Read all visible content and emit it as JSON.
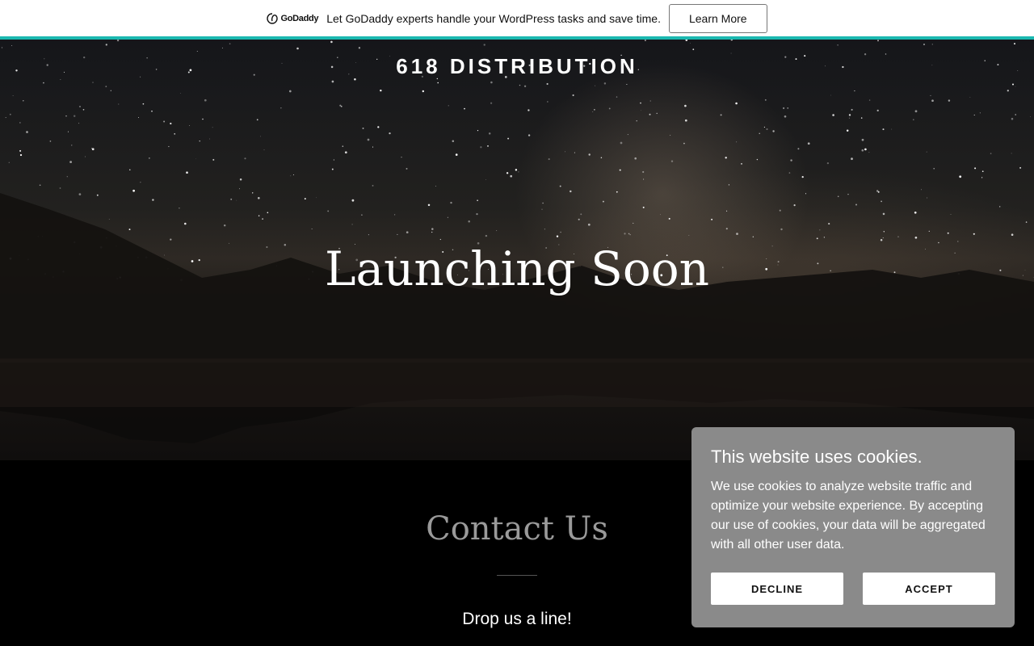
{
  "promo": {
    "logo_text": "GoDaddy",
    "message": "Let GoDaddy experts handle your WordPress tasks and save time.",
    "cta_label": "Learn More",
    "accent_color": "#1bb8b0"
  },
  "hero": {
    "site_name": "618 DISTRIBUTION",
    "headline": "Launching Soon"
  },
  "contact": {
    "title": "Contact Us",
    "subtitle": "Drop us a line!"
  },
  "cookie_banner": {
    "title": "This website uses cookies.",
    "body": "We use cookies to analyze website traffic and optimize your website experience. By accepting our use of cookies, your data will be aggregated with all other user data.",
    "decline_label": "DECLINE",
    "accept_label": "ACCEPT",
    "background_color": "#8a8a8a"
  }
}
